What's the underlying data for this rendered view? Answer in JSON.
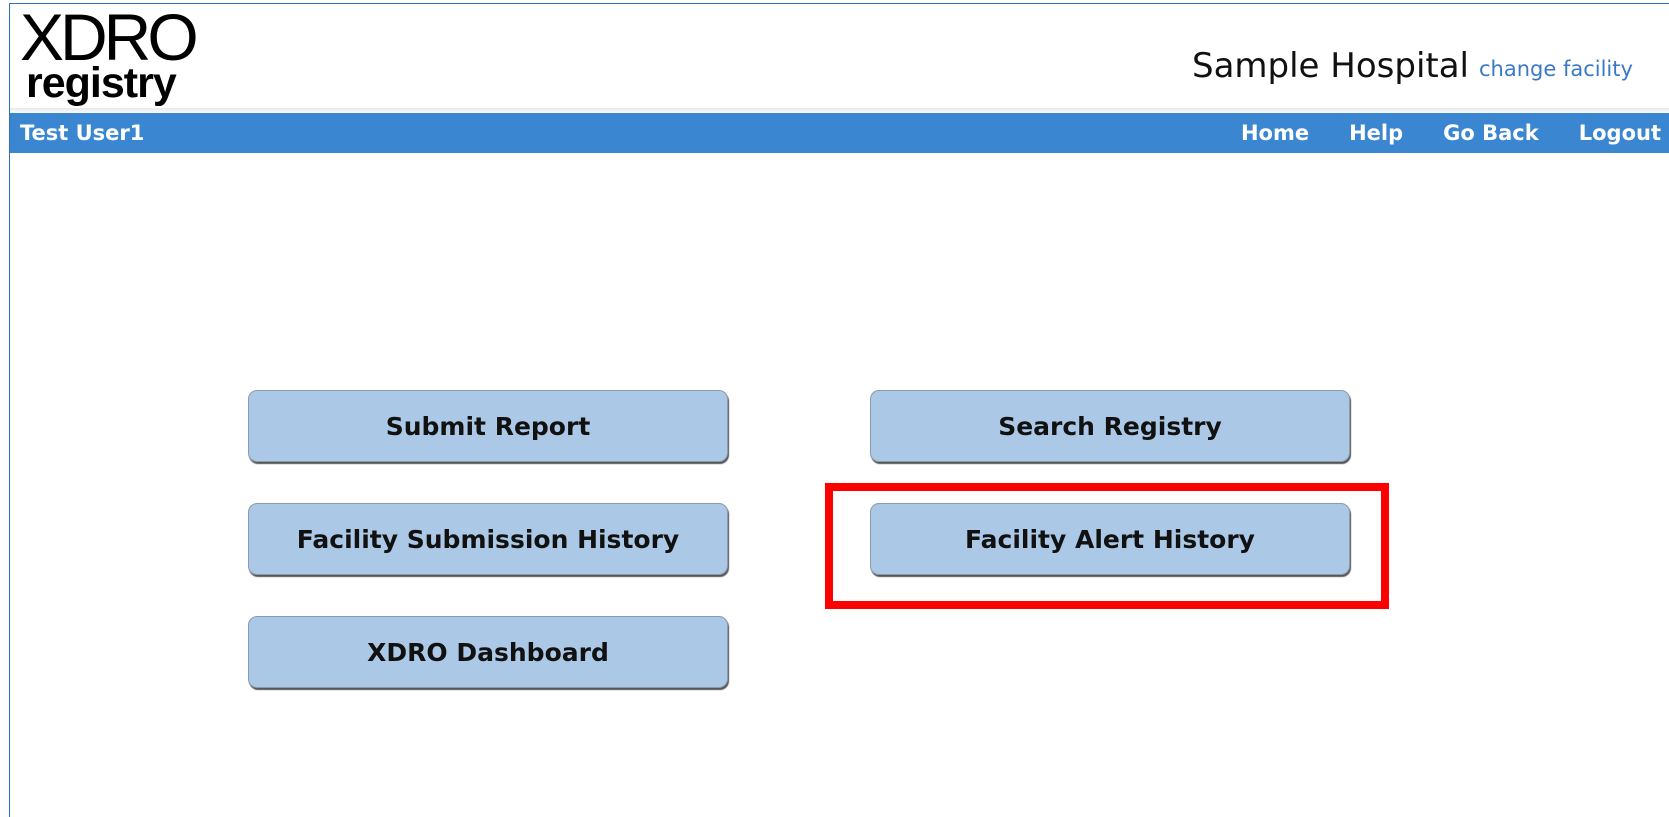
{
  "logo": {
    "line1": "XDRO",
    "line2": "registry"
  },
  "header": {
    "facility_name": "Sample Hospital",
    "change_facility_link": "change facility"
  },
  "navbar": {
    "user_name": "Test User1",
    "links": [
      "Home",
      "Help",
      "Go Back",
      "Logout"
    ]
  },
  "buttons": {
    "submit_report": "Submit Report",
    "search_registry": "Search Registry",
    "facility_submission_history": "Facility Submission History",
    "facility_alert_history": "Facility Alert History",
    "xdro_dashboard": "XDRO Dashboard"
  },
  "colors": {
    "navbar": "#3a86d0",
    "button_bg": "#abc8e6",
    "link": "#3a78c8",
    "highlight": "#ff0000"
  }
}
